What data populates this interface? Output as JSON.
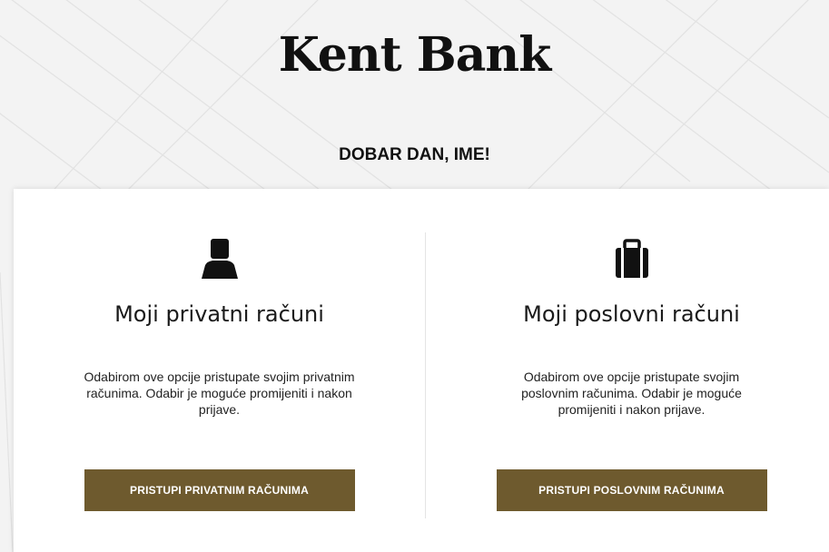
{
  "brand": {
    "name": "Kent Bank",
    "accent": "#6e5a2e"
  },
  "greeting": "DOBAR DAN, IME!",
  "options": [
    {
      "icon": "person-icon",
      "title": "Moji privatni računi",
      "description": "Odabirom ove opcije pristupate svojim privatnim računima. Odabir je moguće promijeniti i nakon prijave.",
      "button_label": "PRISTUPI PRIVATNIM RAČUNIMA"
    },
    {
      "icon": "briefcase-icon",
      "title": "Moji poslovni računi",
      "description": "Odabirom ove opcije pristupate svojim poslovnim računima. Odabir je moguće promijeniti i nakon prijave.",
      "button_label": "PRISTUPI POSLOVNIM RAČUNIMA"
    }
  ]
}
